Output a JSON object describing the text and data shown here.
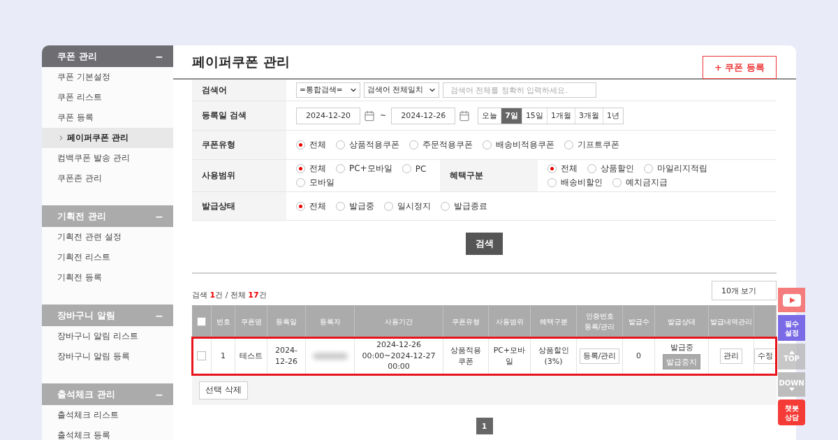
{
  "sidebar": {
    "groups": [
      {
        "title": "쿠폰 관리",
        "toggle": "−",
        "selected": true,
        "items": [
          {
            "label": "쿠폰 기본설정",
            "selected": false
          },
          {
            "label": "쿠폰 리스트",
            "selected": false
          },
          {
            "label": "쿠폰 등록",
            "selected": false
          },
          {
            "label": "페이퍼쿠폰 관리",
            "selected": true
          },
          {
            "label": "컴백쿠폰 발송 관리",
            "selected": false
          },
          {
            "label": "쿠폰존 관리",
            "selected": false
          }
        ]
      },
      {
        "title": "기획전 관리",
        "toggle": "−",
        "selected": false,
        "items": [
          {
            "label": "기획전 관련 설정",
            "selected": false
          },
          {
            "label": "기획전 리스트",
            "selected": false
          },
          {
            "label": "기획전 등록",
            "selected": false
          }
        ]
      },
      {
        "title": "장바구니 알림",
        "toggle": "−",
        "selected": false,
        "items": [
          {
            "label": "장바구니 알림 리스트",
            "selected": false
          },
          {
            "label": "장바구니 알림 등록",
            "selected": false
          }
        ]
      },
      {
        "title": "출석체크 관리",
        "toggle": "−",
        "selected": false,
        "items": [
          {
            "label": "출석체크 리스트",
            "selected": false
          },
          {
            "label": "출석체크 등록",
            "selected": false
          }
        ]
      }
    ]
  },
  "header": {
    "title": "페이퍼쿠폰 관리",
    "register_button": "+ 쿠폰 등록"
  },
  "search_form": {
    "rows": [
      {
        "kind": "keyword",
        "label": "검색어",
        "selects": [
          "=통합검색=",
          "검색어 전체일치"
        ],
        "placeholder": "검색어 전체를 정확히 입력하세요."
      },
      {
        "kind": "date",
        "label": "등록일 검색",
        "from": "2024-12-20",
        "separator": "~",
        "to": "2024-12-26",
        "periods": [
          {
            "label": "오늘",
            "selected": false
          },
          {
            "label": "7일",
            "selected": true
          },
          {
            "label": "15일",
            "selected": false
          },
          {
            "label": "1개월",
            "selected": false
          },
          {
            "label": "3개월",
            "selected": false
          },
          {
            "label": "1년",
            "selected": false
          }
        ]
      },
      {
        "kind": "radio",
        "label": "쿠폰유형",
        "options": [
          {
            "label": "전체",
            "selected": true
          },
          {
            "label": "상품적용쿠폰",
            "selected": false
          },
          {
            "label": "주문적용쿠폰",
            "selected": false
          },
          {
            "label": "배송비적용쿠폰",
            "selected": false
          },
          {
            "label": "기프트쿠폰",
            "selected": false
          }
        ]
      },
      {
        "kind": "radio_pair",
        "label": "사용범위",
        "options": [
          {
            "label": "전체",
            "selected": true
          },
          {
            "label": "PC+모바일",
            "selected": false
          },
          {
            "label": "PC",
            "selected": false
          },
          {
            "label": "모바일",
            "selected": false
          }
        ],
        "label_2": "혜택구분",
        "options_2": [
          {
            "label": "전체",
            "selected": true
          },
          {
            "label": "상품할인",
            "selected": false
          },
          {
            "label": "마일리지적립",
            "selected": false
          },
          {
            "label": "배송비할인",
            "selected": false
          },
          {
            "label": "예치금지급",
            "selected": false
          }
        ]
      },
      {
        "kind": "radio",
        "label": "발급상태",
        "options": [
          {
            "label": "전체",
            "selected": true
          },
          {
            "label": "발급중",
            "selected": false
          },
          {
            "label": "일시정지",
            "selected": false
          },
          {
            "label": "발급종료",
            "selected": false
          }
        ]
      }
    ],
    "search_button": "검색"
  },
  "results": {
    "summary": "검색 **1**건 / 전체 **17**건",
    "page_size": "10개 보기"
  },
  "table": {
    "header_checked": false,
    "columns": [
      "번호",
      "쿠폰명",
      "등록일",
      "등록자",
      "사용기간",
      "쿠폰유형",
      "사용범위",
      "혜택구분",
      "인증번호 등록/관리",
      "발급수",
      "발급상태",
      "발급내역관리"
    ],
    "rows": [
      {
        "checked": false,
        "highlighted": true,
        "number": "1",
        "name": "테스트",
        "date": "2024-12-26",
        "period": "2024-12-26 00:00~2024-12-27 00:00",
        "type": "상품적용쿠폰",
        "scope": "PC+모바일",
        "benefit": "상품할인(3%)",
        "cert_button": "등록/관리",
        "count": "0",
        "status": "발급중",
        "status_button": "발급중지",
        "history_button": "관리",
        "edit_button": "수정"
      }
    ]
  },
  "footer": {
    "delete_button": "선택 삭제"
  },
  "pagination": [
    {
      "label": "1",
      "selected": true
    }
  ],
  "floating_buttons": [
    {
      "kind": "video",
      "color": "#f47c7c"
    },
    {
      "kind": "label",
      "label": "필수 설정",
      "color": "#7a6ae6"
    },
    {
      "kind": "top",
      "label": "TOP"
    },
    {
      "kind": "down",
      "label": "DOWN",
      "color": "#bdbdbd"
    },
    {
      "kind": "label",
      "label": "챗봇 상담",
      "color": "#f53b36"
    }
  ]
}
